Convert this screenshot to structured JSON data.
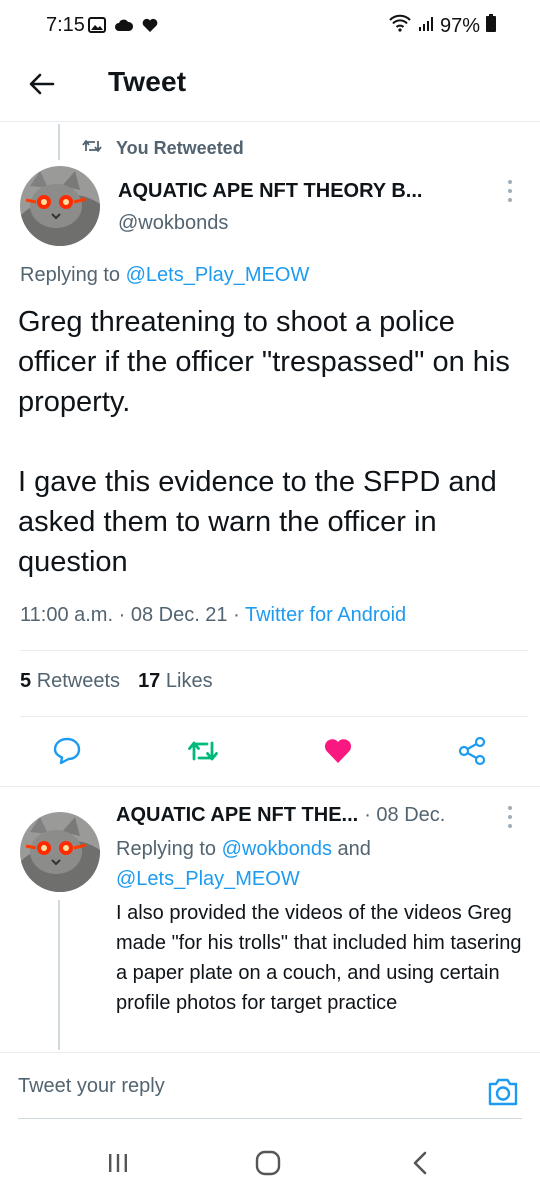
{
  "status_bar": {
    "time": "7:15",
    "battery": "97%",
    "icons": [
      "image-icon",
      "cloud-icon",
      "heart-icon",
      "wifi-icon",
      "signal-icon",
      "battery-icon"
    ]
  },
  "header": {
    "title": "Tweet",
    "back_icon": "arrow-left-icon"
  },
  "retweet_context": {
    "label": "You Retweeted",
    "icon": "retweet-icon"
  },
  "tweet": {
    "author_name": "AQUATIC APE NFT THEORY B...",
    "handle": "@wokbonds",
    "replying_prefix": "Replying to ",
    "replying_to": "@Lets_Play_MEOW",
    "text_p1": "Greg threatening to shoot a police officer if the officer \"trespassed\" on his property.",
    "text_p2": "I gave this evidence to the SFPD and asked them to warn the officer in question",
    "time": "11:00 a.m.",
    "date": "08 Dec. 21",
    "separator": "·",
    "source": "Twitter for Android",
    "retweets_count": "5",
    "retweets_label": "Retweets",
    "likes_count": "17",
    "likes_label": "Likes",
    "liked": true,
    "retweeted": true
  },
  "reply": {
    "author_name": "AQUATIC APE NFT THE...",
    "date": "· 08 Dec.",
    "replying_prefix": "Replying to ",
    "replying_to_1": "@wokbonds",
    "replying_and": " and ",
    "replying_to_2": "@Lets_Play_MEOW",
    "text": "I also provided the videos of the videos Greg made \"for his trolls\" that included him tasering a paper plate on a couch, and using certain profile photos for target practice"
  },
  "compose": {
    "placeholder": "Tweet your reply",
    "camera_icon": "camera-icon"
  },
  "colors": {
    "accent": "#1d9bf0",
    "retweet_green": "#00ba7c",
    "like_pink": "#f91880",
    "secondary_text": "#536471"
  }
}
